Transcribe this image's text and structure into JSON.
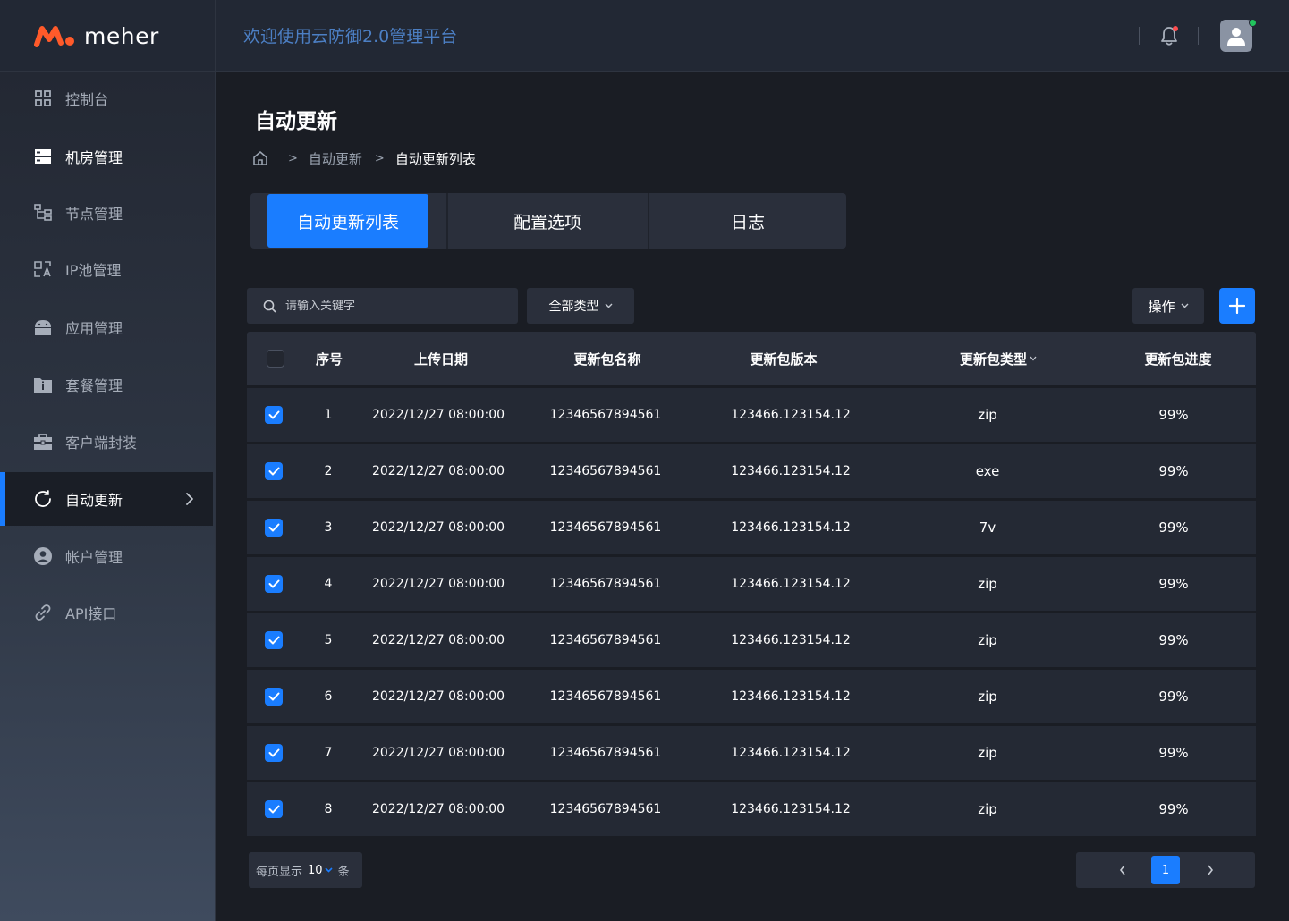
{
  "header": {
    "logo_text": "meher",
    "welcome": "欢迎使用云防御2.0管理平台"
  },
  "sidebar": {
    "items": [
      {
        "label": "控制台",
        "icon": "grid-icon"
      },
      {
        "label": "机房管理",
        "icon": "server-icon"
      },
      {
        "label": "节点管理",
        "icon": "tree-icon"
      },
      {
        "label": "IP池管理",
        "icon": "translate-icon"
      },
      {
        "label": "应用管理",
        "icon": "android-icon"
      },
      {
        "label": "套餐管理",
        "icon": "folder-info-icon"
      },
      {
        "label": "客户端封装",
        "icon": "toolbox-icon"
      },
      {
        "label": "自动更新",
        "icon": "refresh-icon"
      },
      {
        "label": "帐户管理",
        "icon": "account-icon"
      },
      {
        "label": "API接口",
        "icon": "link-icon"
      }
    ],
    "active_index": 7
  },
  "page": {
    "title": "自动更新",
    "breadcrumb": [
      "自动更新",
      "自动更新列表"
    ]
  },
  "tabs": [
    "自动更新列表",
    "配置选项",
    "日志"
  ],
  "toolbar": {
    "search_placeholder": "请输入关键字",
    "type_filter": "全部类型",
    "actions_label": "操作"
  },
  "table": {
    "headers": [
      "序号",
      "上传日期",
      "更新包名称",
      "更新包版本",
      "更新包类型",
      "更新包进度"
    ],
    "rows": [
      {
        "checked": true,
        "index": "1",
        "date": "2022/12/27 08:00:00",
        "name": "12346567894561",
        "version": "123466.123154.12",
        "type": "zip",
        "progress": "99%"
      },
      {
        "checked": true,
        "index": "2",
        "date": "2022/12/27 08:00:00",
        "name": "12346567894561",
        "version": "123466.123154.12",
        "type": "exe",
        "progress": "99%"
      },
      {
        "checked": true,
        "index": "3",
        "date": "2022/12/27 08:00:00",
        "name": "12346567894561",
        "version": "123466.123154.12",
        "type": "7v",
        "progress": "99%"
      },
      {
        "checked": true,
        "index": "4",
        "date": "2022/12/27 08:00:00",
        "name": "12346567894561",
        "version": "123466.123154.12",
        "type": "zip",
        "progress": "99%"
      },
      {
        "checked": true,
        "index": "5",
        "date": "2022/12/27 08:00:00",
        "name": "12346567894561",
        "version": "123466.123154.12",
        "type": "zip",
        "progress": "99%"
      },
      {
        "checked": true,
        "index": "6",
        "date": "2022/12/27 08:00:00",
        "name": "12346567894561",
        "version": "123466.123154.12",
        "type": "zip",
        "progress": "99%"
      },
      {
        "checked": true,
        "index": "7",
        "date": "2022/12/27 08:00:00",
        "name": "12346567894561",
        "version": "123466.123154.12",
        "type": "zip",
        "progress": "99%"
      },
      {
        "checked": true,
        "index": "8",
        "date": "2022/12/27 08:00:00",
        "name": "12346567894561",
        "version": "123466.123154.12",
        "type": "zip",
        "progress": "99%"
      }
    ]
  },
  "footer": {
    "per_page_prefix": "每页显示",
    "per_page_value": "10",
    "per_page_suffix": "条",
    "current_page": "1"
  },
  "colors": {
    "accent": "#1a7dff",
    "logo_orange": "#ff5a2a",
    "welcome_text": "#4c7fc4",
    "online_dot": "#21c45d",
    "alert_dot": "#ff4d4f"
  }
}
